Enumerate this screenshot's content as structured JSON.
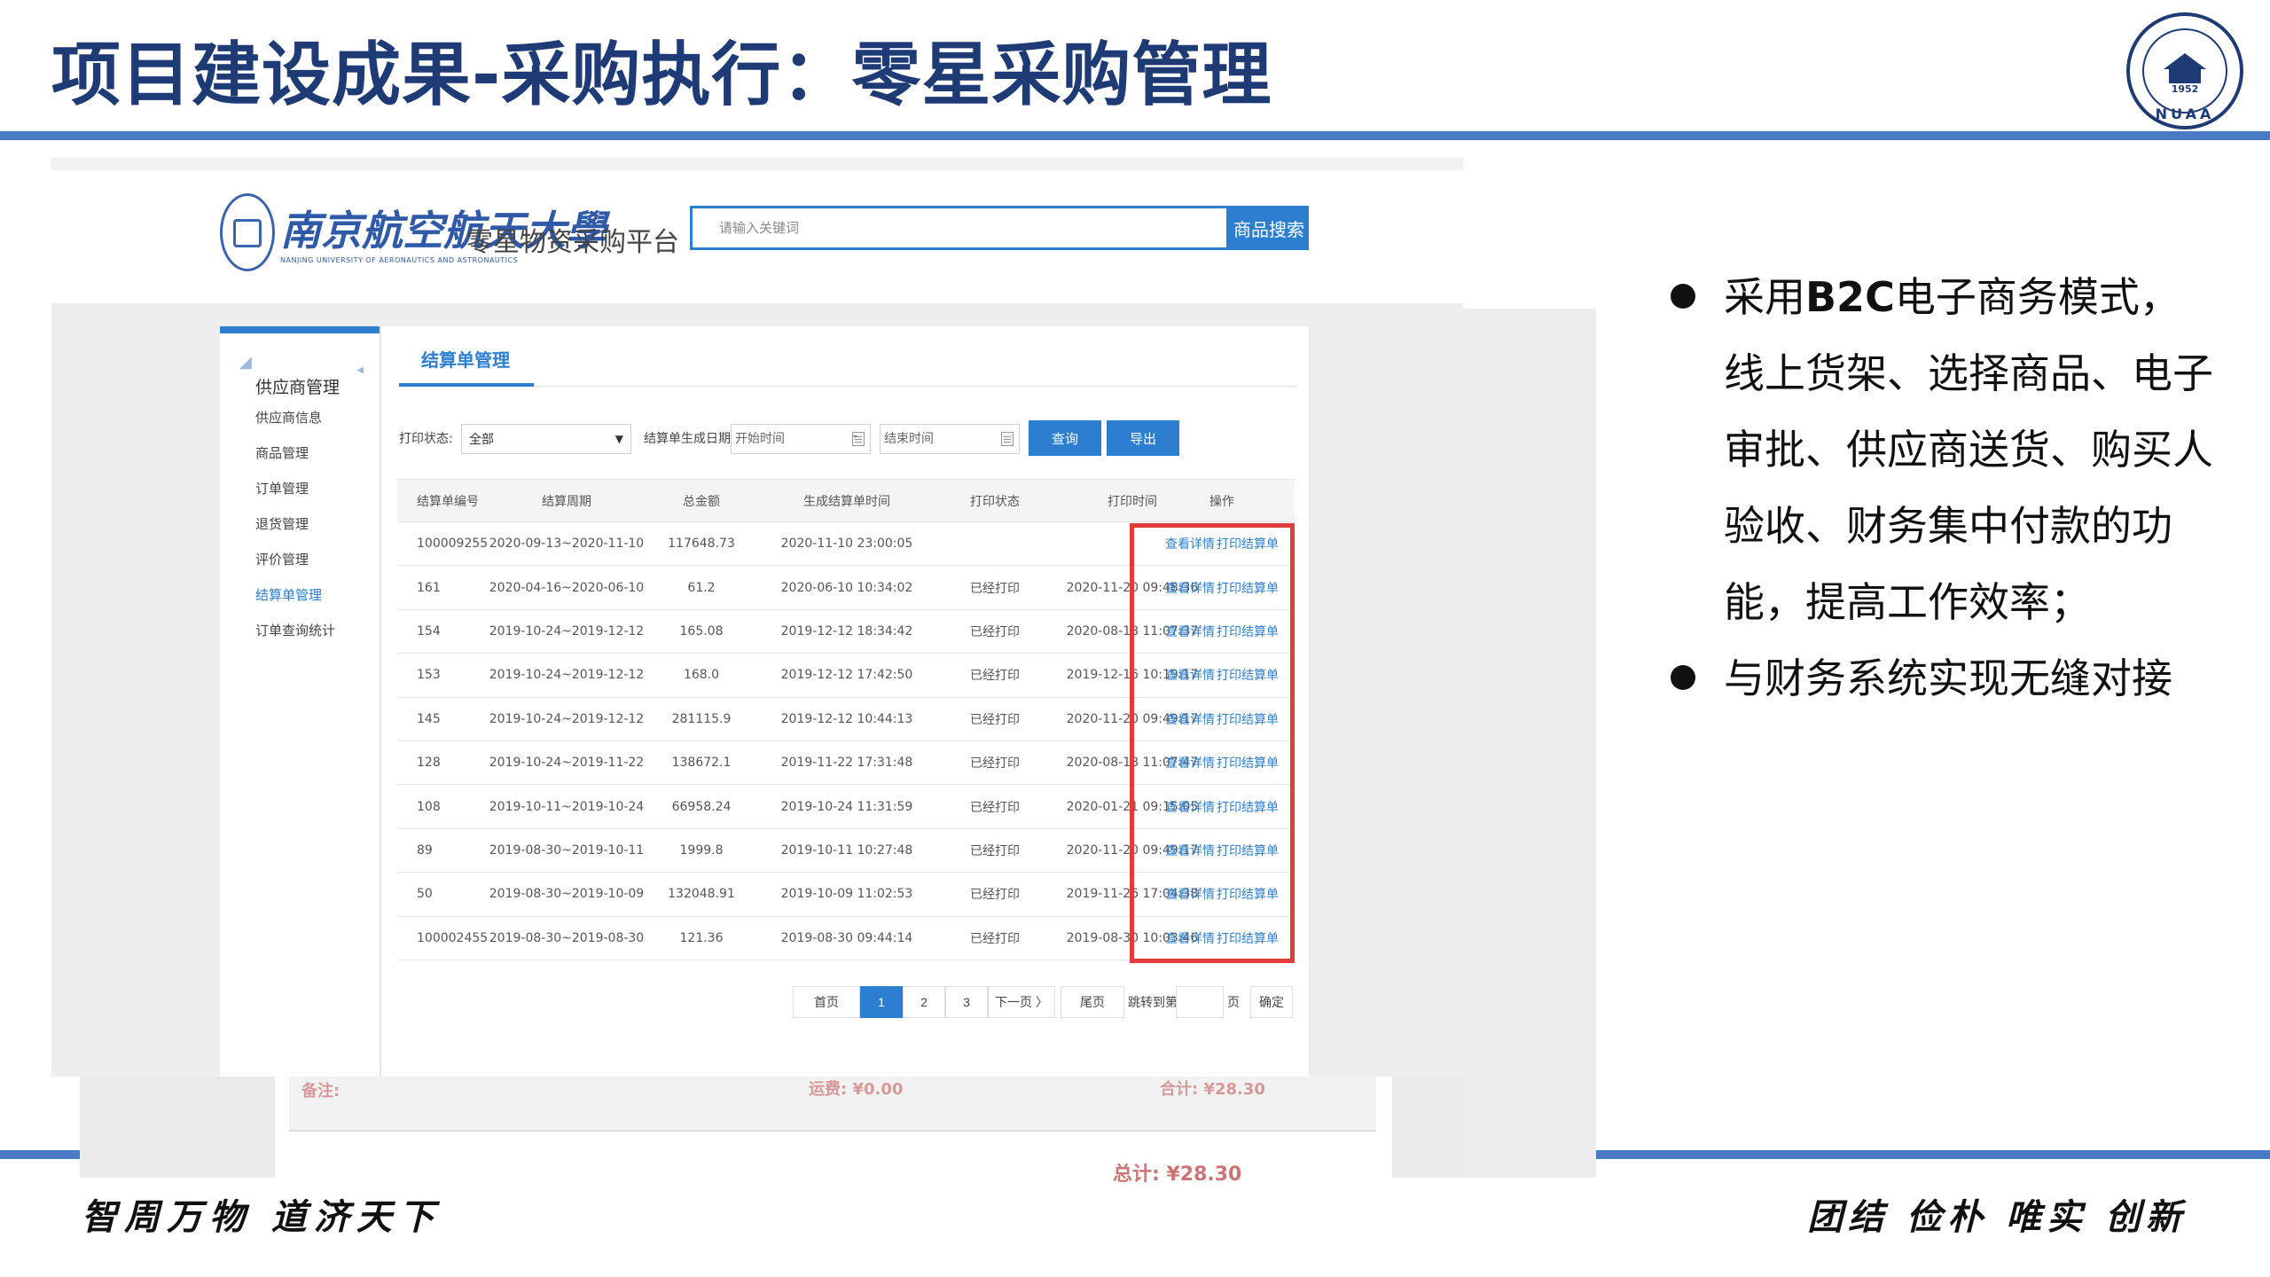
{
  "slide": {
    "title": "项目建设成果-采购执行：零星采购管理",
    "motto_left": "智周万物 道济天下",
    "motto_right": "团结 俭朴 唯实 创新",
    "seal": {
      "year": "1952",
      "abbr": "NUAA"
    }
  },
  "site": {
    "university_name": "南京航空航天大學",
    "university_name_en": "NANJING UNIVERSITY OF AERONAUTICS AND ASTRONAUTICS",
    "platform_name": "零星物资采购平台",
    "search_placeholder": "请输入关键词",
    "search_button": "商品搜索"
  },
  "sidebar": {
    "title": "供应商管理",
    "items": [
      {
        "label": "供应商信息",
        "active": false
      },
      {
        "label": "商品管理",
        "active": false
      },
      {
        "label": "订单管理",
        "active": false
      },
      {
        "label": "退货管理",
        "active": false
      },
      {
        "label": "评价管理",
        "active": false
      },
      {
        "label": "结算单管理",
        "active": true
      },
      {
        "label": "订单查询统计",
        "active": false
      }
    ]
  },
  "main": {
    "tab_label": "结算单管理",
    "filters": {
      "print_status_label": "打印状态:",
      "print_status_value": "全部",
      "date_label": "结算单生成日期:",
      "start_placeholder": "开始时间",
      "end_placeholder": "结束时间",
      "separator": "-",
      "query_button": "查询",
      "export_button": "导出"
    },
    "table": {
      "headers": [
        "结算单编号",
        "结算周期",
        "总金额",
        "生成结算单时间",
        "打印状态",
        "打印时间",
        "操作"
      ],
      "action_detail": "查看详情",
      "action_print": "打印结算单",
      "rows": [
        {
          "id": "100009255",
          "period": "2020-09-13~2020-11-10",
          "amount": "117648.73",
          "generated": "2020-11-10 23:00:05",
          "status": "",
          "printed": ""
        },
        {
          "id": "161",
          "period": "2020-04-16~2020-06-10",
          "amount": "61.2",
          "generated": "2020-06-10 10:34:02",
          "status": "已经打印",
          "printed": "2020-11-20 09:48:36"
        },
        {
          "id": "154",
          "period": "2019-10-24~2019-12-12",
          "amount": "165.08",
          "generated": "2019-12-12 18:34:42",
          "status": "已经打印",
          "printed": "2020-08-18 11:07:37"
        },
        {
          "id": "153",
          "period": "2019-10-24~2019-12-12",
          "amount": "168.0",
          "generated": "2019-12-12 17:42:50",
          "status": "已经打印",
          "printed": "2019-12-16 10:19:17"
        },
        {
          "id": "145",
          "period": "2019-10-24~2019-12-12",
          "amount": "281115.9",
          "generated": "2019-12-12 10:44:13",
          "status": "已经打印",
          "printed": "2020-11-20 09:49:17"
        },
        {
          "id": "128",
          "period": "2019-10-24~2019-11-22",
          "amount": "138672.1",
          "generated": "2019-11-22 17:31:48",
          "status": "已经打印",
          "printed": "2020-08-18 11:07:47"
        },
        {
          "id": "108",
          "period": "2019-10-11~2019-10-24",
          "amount": "66958.24",
          "generated": "2019-10-24 11:31:59",
          "status": "已经打印",
          "printed": "2020-01-21 09:15:05"
        },
        {
          "id": "89",
          "period": "2019-08-30~2019-10-11",
          "amount": "1999.8",
          "generated": "2019-10-11 10:27:48",
          "status": "已经打印",
          "printed": "2020-11-20 09:49:17"
        },
        {
          "id": "50",
          "period": "2019-08-30~2019-10-09",
          "amount": "132048.91",
          "generated": "2019-10-09 11:02:53",
          "status": "已经打印",
          "printed": "2019-11-26 17:04:38"
        },
        {
          "id": "100002455",
          "period": "2019-08-30~2019-08-30",
          "amount": "121.36",
          "generated": "2019-08-30 09:44:14",
          "status": "已经打印",
          "printed": "2019-08-30 10:03:46"
        }
      ]
    },
    "pagination": {
      "first": "首页",
      "pages": [
        "1",
        "2",
        "3"
      ],
      "current": "1",
      "next": "下一页 〉",
      "last": "尾页",
      "jump_label": "跳转到第",
      "page_unit": "页",
      "confirm": "确定"
    }
  },
  "underlay": {
    "remark_label": "备注:",
    "shipping": "运费: ¥0.00",
    "subtotal": "合计: ¥28.30",
    "total": "总计: ¥28.30"
  },
  "bullets": [
    {
      "prefix": "采用",
      "bold": "B2C",
      "suffix": "电子商务模式，线上货架、选择商品、电子审批、供应商送货、购买人验收、财务集中付款的功能，提高工作效率；"
    },
    {
      "prefix": "与财务系统实现无缝对接",
      "bold": "",
      "suffix": ""
    }
  ],
  "colors": {
    "title": "#1f3b76",
    "rule": "#4a7cc6",
    "accent": "#2c7fd0",
    "highlight": "#e33b3b"
  }
}
